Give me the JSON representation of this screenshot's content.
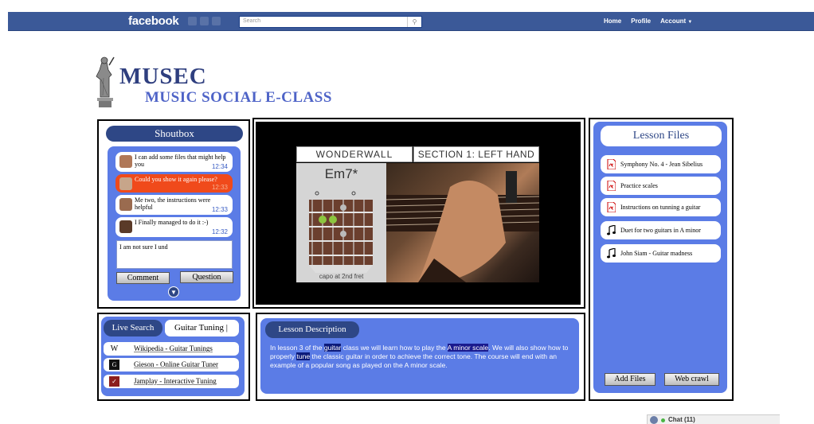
{
  "facebook_bar": {
    "logo": "facebook",
    "search_placeholder": "Search",
    "nav": {
      "home": "Home",
      "profile": "Profile",
      "account": "Account"
    }
  },
  "app": {
    "title": "MUSEC",
    "subtitle": "MUSIC SOCIAL E-CLASS"
  },
  "shoutbox": {
    "title": "Shoutbox",
    "messages": [
      {
        "text": "I can add some files that might help you",
        "time": "12:34",
        "highlighted": false
      },
      {
        "text": "Could you show it again please?",
        "time": "12:33",
        "highlighted": true
      },
      {
        "text": "Me two, the instructions were helpful",
        "time": "12:33",
        "highlighted": false
      },
      {
        "text": "I Finally managed to do it :-)",
        "time": "12:32",
        "highlighted": false
      }
    ],
    "input_value": "I am not sure I und",
    "comment_button": "Comment",
    "question_button": "Question"
  },
  "video": {
    "song": "WONDERWALL",
    "section": "SECTION 1: LEFT HAND",
    "chord": "Em7*",
    "capo": "capo at 2nd fret"
  },
  "lesson_files": {
    "title": "Lesson Files",
    "files": [
      {
        "name": "Symphony No. 4 - Jean Sibelius",
        "icon": "pdf-icon"
      },
      {
        "name": "Practice scales",
        "icon": "pdf-icon"
      },
      {
        "name": "Instructions on tunning a guitar",
        "icon": "pdf-icon"
      },
      {
        "name": "Duet for two guitars in A minor",
        "icon": "music-note-icon"
      },
      {
        "name": "John Siam - Guitar madness",
        "icon": "music-note-icon"
      }
    ],
    "add_files_button": "Add Files",
    "web_crawl_button": "Web crawl"
  },
  "live_search": {
    "title": "Live Search",
    "query": "Guitar Tuning",
    "results": [
      {
        "label": "Wikipedia - Guitar Tunings",
        "icon": "wikipedia-icon"
      },
      {
        "label": "Gieson - Online Guitar Tuner",
        "icon": "gieson-icon"
      },
      {
        "label": "Jamplay - Interactive Tuning",
        "icon": "jamplay-icon"
      }
    ]
  },
  "lesson_description": {
    "title": "Lesson Description",
    "t1": "In lesson 3 of the ",
    "k1": "guitar",
    "t2": " class we will learn how to play the ",
    "k2": "A minor scale",
    "t3": ". We will also show how to properly ",
    "k3": "tune",
    "t4": " the classic guitar in order to achieve the correct tone. The course will end with an example of a popular song as played on the A minor scale."
  },
  "chat": {
    "label": "Chat (11)"
  },
  "colors": {
    "facebook_blue": "#3b5998",
    "panel_blue": "#5b7ce6",
    "title_navy": "#2e4786",
    "alert_orange": "#f04a1b"
  }
}
